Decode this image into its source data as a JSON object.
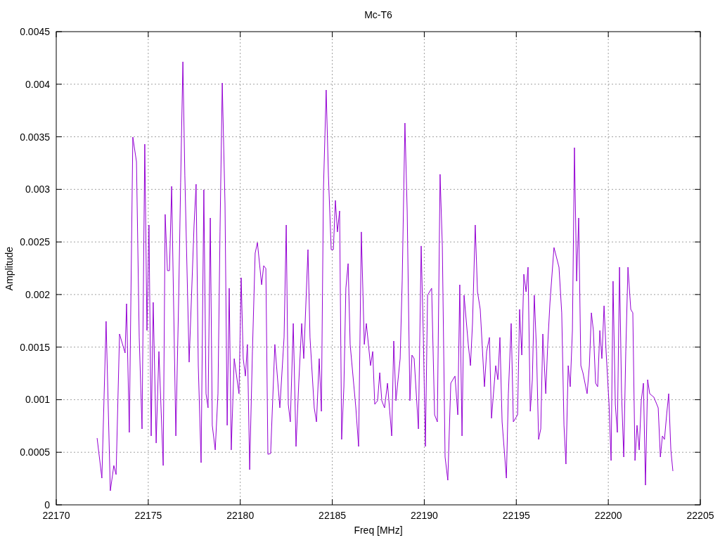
{
  "chart_data": {
    "type": "line",
    "grid": true,
    "title": "Mc-T6",
    "xlabel": "Freq [MHz]",
    "ylabel": "Amplitude",
    "xlim": [
      22170,
      22205
    ],
    "ylim": [
      0,
      0.0045
    ],
    "xticks": [
      22170,
      22175,
      22180,
      22185,
      22190,
      22195,
      22200,
      22205
    ],
    "yticks": [
      0,
      0.0005,
      0.001,
      0.0015,
      0.002,
      0.0025,
      0.003,
      0.0035,
      0.004,
      0.0045
    ],
    "x": [
      22172.22,
      22172.48,
      22172.71,
      22172.94,
      22173.13,
      22173.25,
      22173.44,
      22173.74,
      22173.82,
      22173.97,
      22174.16,
      22174.36,
      22174.51,
      22174.66,
      22174.81,
      22174.93,
      22175.04,
      22175.16,
      22175.27,
      22175.43,
      22175.58,
      22175.81,
      22175.92,
      22176.04,
      22176.15,
      22176.27,
      22176.5,
      22176.65,
      22176.76,
      22176.88,
      22176.99,
      22177.22,
      22177.49,
      22177.6,
      22177.72,
      22177.87,
      22178.02,
      22178.14,
      22178.25,
      22178.37,
      22178.48,
      22178.64,
      22178.79,
      22178.9,
      22179.02,
      22179.17,
      22179.29,
      22179.4,
      22179.51,
      22179.67,
      22179.93,
      22180.05,
      22180.16,
      22180.28,
      22180.39,
      22180.51,
      22180.66,
      22180.81,
      22180.93,
      22181.16,
      22181.27,
      22181.39,
      22181.5,
      22181.65,
      22181.88,
      22182.15,
      22182.38,
      22182.5,
      22182.61,
      22182.72,
      22182.88,
      22183.03,
      22183.18,
      22183.34,
      22183.45,
      22183.68,
      22183.79,
      22184.02,
      22184.14,
      22184.29,
      22184.41,
      22184.52,
      22184.67,
      22184.79,
      22184.94,
      22185.06,
      22185.17,
      22185.28,
      22185.4,
      22185.51,
      22185.63,
      22185.74,
      22185.86,
      22185.97,
      22186.28,
      22186.43,
      22186.58,
      22186.74,
      22186.85,
      22187.08,
      22187.2,
      22187.31,
      22187.46,
      22187.58,
      22187.69,
      22187.84,
      22188.0,
      22188.23,
      22188.34,
      22188.46,
      22188.69,
      22188.8,
      22188.95,
      22189.07,
      22189.22,
      22189.33,
      22189.45,
      22189.68,
      22189.83,
      22189.95,
      22190.06,
      22190.18,
      22190.4,
      22190.56,
      22190.71,
      22190.86,
      22190.98,
      22191.13,
      22191.28,
      22191.44,
      22191.67,
      22191.82,
      22191.93,
      22192.05,
      22192.16,
      22192.39,
      22192.51,
      22192.62,
      22192.77,
      22192.89,
      22193.04,
      22193.27,
      22193.39,
      22193.54,
      22193.65,
      22193.88,
      22194.0,
      22194.11,
      22194.23,
      22194.46,
      22194.57,
      22194.72,
      22194.84,
      22195.07,
      22195.18,
      22195.3,
      22195.41,
      22195.53,
      22195.64,
      22195.76,
      22195.87,
      22195.98,
      22196.1,
      22196.21,
      22196.33,
      22196.44,
      22196.6,
      22196.71,
      22196.83,
      22197.05,
      22197.32,
      22197.47,
      22197.59,
      22197.7,
      22197.82,
      22197.93,
      22198.05,
      22198.16,
      22198.28,
      22198.39,
      22198.51,
      22198.62,
      22198.85,
      22198.97,
      22199.08,
      22199.19,
      22199.31,
      22199.42,
      22199.54,
      22199.65,
      22199.77,
      22199.88,
      22200.04,
      22200.15,
      22200.26,
      22200.38,
      22200.49,
      22200.61,
      22200.72,
      22200.84,
      22200.95,
      22201.07,
      22201.22,
      22201.33,
      22201.45,
      22201.56,
      22201.68,
      22201.79,
      22201.91,
      22202.02,
      22202.14,
      22202.25,
      22202.48,
      22202.71,
      22202.83,
      22202.94,
      22203.05,
      22203.17,
      22203.28,
      22203.4,
      22203.51
    ],
    "series": [
      {
        "color": "#9400d3",
        "values": [
          0.000635,
          0.000254,
          0.001745,
          0.000134,
          0.000374,
          0.000288,
          0.001625,
          0.001444,
          0.001912,
          0.000689,
          0.003497,
          0.003263,
          0.001592,
          0.000722,
          0.00343,
          0.001658,
          0.002661,
          0.000655,
          0.001926,
          0.000588,
          0.001458,
          0.000374,
          0.002762,
          0.002227,
          0.002227,
          0.003029,
          0.000655,
          0.001926,
          0.003063,
          0.004213,
          0.00313,
          0.001357,
          0.002661,
          0.003049,
          0.001324,
          0.000401,
          0.002996,
          0.001057,
          0.000923,
          0.002728,
          0.000756,
          0.000522,
          0.001057,
          0.002595,
          0.004012,
          0.002862,
          0.000756,
          0.00206,
          0.000522,
          0.001391,
          0.001057,
          0.00216,
          0.001391,
          0.001224,
          0.001525,
          0.000334,
          0.001458,
          0.002394,
          0.002494,
          0.002093,
          0.002274,
          0.002247,
          0.000481,
          0.000488,
          0.001525,
          0.000923,
          0.001592,
          0.002661,
          0.000956,
          0.000789,
          0.001725,
          0.000555,
          0.001157,
          0.001725,
          0.001391,
          0.002427,
          0.001592,
          0.000923,
          0.000789,
          0.001391,
          0.000889,
          0.002996,
          0.003945,
          0.00313,
          0.002427,
          0.002427,
          0.002895,
          0.002595,
          0.002795,
          0.000622,
          0.001123,
          0.00206,
          0.002294,
          0.001525,
          0.000923,
          0.000555,
          0.002595,
          0.001525,
          0.001725,
          0.001324,
          0.001458,
          0.000956,
          0.00099,
          0.001257,
          0.00099,
          0.000923,
          0.001157,
          0.000655,
          0.001558,
          0.00099,
          0.001391,
          0.002127,
          0.003631,
          0.002795,
          0.00099,
          0.001424,
          0.001391,
          0.000722,
          0.002461,
          0.001592,
          0.000555,
          0.001993,
          0.00206,
          0.000856,
          0.000789,
          0.003143,
          0.002461,
          0.000455,
          0.000234,
          0.001157,
          0.001224,
          0.000856,
          0.002093,
          0.000655,
          0.001993,
          0.001525,
          0.001324,
          0.001725,
          0.002661,
          0.002026,
          0.001859,
          0.001123,
          0.001458,
          0.001592,
          0.000823,
          0.001324,
          0.00119,
          0.001592,
          0.000789,
          0.000254,
          0.001057,
          0.001725,
          0.000789,
          0.000856,
          0.001859,
          0.001424,
          0.002193,
          0.002026,
          0.00226,
          0.000889,
          0.00119,
          0.001993,
          0.001458,
          0.000622,
          0.000722,
          0.001625,
          0.001057,
          0.001525,
          0.001926,
          0.002447,
          0.00226,
          0.001826,
          0.000756,
          0.000388,
          0.001324,
          0.001123,
          0.001658,
          0.003397,
          0.002127,
          0.002728,
          0.001324,
          0.001257,
          0.001057,
          0.001324,
          0.001826,
          0.001658,
          0.001157,
          0.001123,
          0.001658,
          0.001391,
          0.001893,
          0.001458,
          0.000956,
          0.000421,
          0.002127,
          0.000956,
          0.000689,
          0.00226,
          0.001057,
          0.000455,
          0.001458,
          0.00226,
          0.001859,
          0.001826,
          0.000421,
          0.000756,
          0.000522,
          0.00099,
          0.001157,
          0.000187,
          0.00119,
          0.001057,
          0.001023,
          0.000923,
          0.000455,
          0.000655,
          0.000622,
          0.000856,
          0.001057,
          0.000522,
          0.000321
        ]
      }
    ]
  }
}
